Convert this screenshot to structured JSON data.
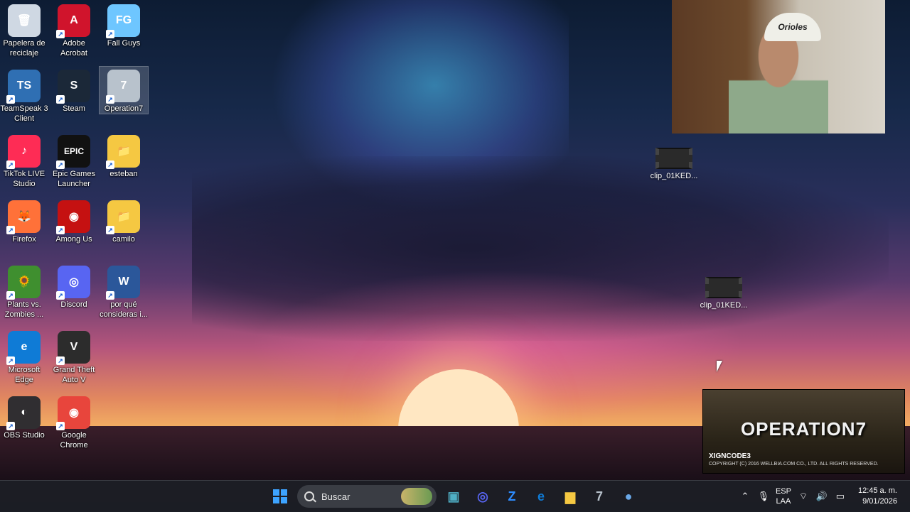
{
  "desktop_icons": [
    {
      "name": "Papelera de reciclaje",
      "glyph": "🗑",
      "color": "#cfd8e3"
    },
    {
      "name": "Adobe Acrobat",
      "glyph": "A",
      "color": "#d0142c"
    },
    {
      "name": "Fall Guys",
      "glyph": "FG",
      "color": "#6ec6ff"
    },
    {
      "name": "TeamSpeak 3 Client",
      "glyph": "TS",
      "color": "#2f6fb3"
    },
    {
      "name": "Steam",
      "glyph": "S",
      "color": "#1b2838"
    },
    {
      "name": "Operation7",
      "glyph": "7",
      "color": "#b8c2cc"
    },
    {
      "name": "TikTok LIVE Studio",
      "glyph": "♪",
      "color": "#fe2c55"
    },
    {
      "name": "Epic Games Launcher",
      "glyph": "EPIC",
      "color": "#111111"
    },
    {
      "name": "esteban",
      "glyph": "📁",
      "color": "#f5c842"
    },
    {
      "name": "Firefox",
      "glyph": "🦊",
      "color": "#ff7139"
    },
    {
      "name": "Among Us",
      "glyph": "◉",
      "color": "#c51111"
    },
    {
      "name": "camilo",
      "glyph": "📁",
      "color": "#f5c842"
    },
    {
      "name": "Plants vs. Zombies ...",
      "glyph": "🌻",
      "color": "#3f8f2f"
    },
    {
      "name": "Discord",
      "glyph": "◎",
      "color": "#5865f2"
    },
    {
      "name": "por qué consideras i...",
      "glyph": "W",
      "color": "#2b579a"
    },
    {
      "name": "Microsoft Edge",
      "glyph": "e",
      "color": "#0f7bd6"
    },
    {
      "name": "Grand Theft Auto V",
      "glyph": "V",
      "color": "#2c2c2c"
    },
    {
      "name": "OBS Studio",
      "glyph": "◐",
      "color": "#302e31"
    },
    {
      "name": "Google Chrome",
      "glyph": "◉",
      "color": "#e8453c"
    }
  ],
  "desktop_files": [
    {
      "name": "clip_01KED..."
    },
    {
      "name": "clip_01KED..."
    }
  ],
  "webcam": {
    "cap_text": "Orioles"
  },
  "game_banner": {
    "title": "OPERATION7",
    "subtitle": "XIGNCODE3",
    "copyright": "COPYRIGHT (C) 2016 WELLBIA.COM CO., LTD. ALL RIGHTS RESERVED."
  },
  "taskbar": {
    "search_label": "Buscar",
    "apps": [
      {
        "name": "file-explorer-icon",
        "glyph": "▣",
        "color": "#4fb0c6"
      },
      {
        "name": "discord-icon",
        "glyph": "◎",
        "color": "#5865f2"
      },
      {
        "name": "zoom-icon",
        "glyph": "Z",
        "color": "#2d8cff"
      },
      {
        "name": "edge-icon",
        "glyph": "e",
        "color": "#0f7bd6"
      },
      {
        "name": "folder-icon",
        "glyph": "▆",
        "color": "#f5c842"
      },
      {
        "name": "operation7-icon",
        "glyph": "7",
        "color": "#b8c2cc"
      },
      {
        "name": "teamspeak-icon",
        "glyph": "●",
        "color": "#6aa8e8"
      }
    ],
    "tray": {
      "lang_top": "ESP",
      "lang_bottom": "LAA",
      "time": "12:45 a. m.",
      "date": "9/01/2026"
    }
  }
}
